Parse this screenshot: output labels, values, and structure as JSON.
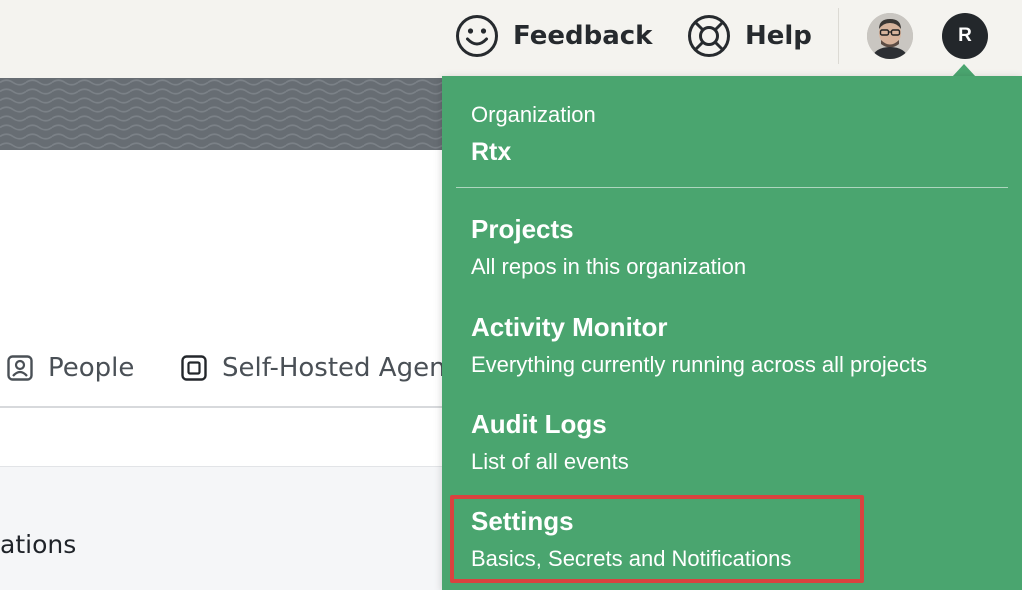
{
  "topbar": {
    "feedback_label": "Feedback",
    "help_label": "Help",
    "avatar_initial": "R"
  },
  "tabs": [
    {
      "label": "People",
      "icon": "person-badge-icon"
    },
    {
      "label": "Self-Hosted Agen",
      "icon": "agent-chip-icon"
    }
  ],
  "content": {
    "partial_text": "ations"
  },
  "dropdown": {
    "org_label": "Organization",
    "org_name": "Rtx",
    "items": [
      {
        "title": "Projects",
        "description": "All repos in this organization"
      },
      {
        "title": "Activity Monitor",
        "description": "Everything currently running across all projects"
      },
      {
        "title": "Audit Logs",
        "description": "List of all events"
      },
      {
        "title": "Settings",
        "description": "Basics, Secrets and Notifications"
      }
    ]
  },
  "colors": {
    "dropdown_bg": "#4aa56f",
    "topbar_bg": "#f4f3ef",
    "banner_bg": "#676d73",
    "highlight": "#d9433f",
    "avatar_bg": "#23272b"
  }
}
